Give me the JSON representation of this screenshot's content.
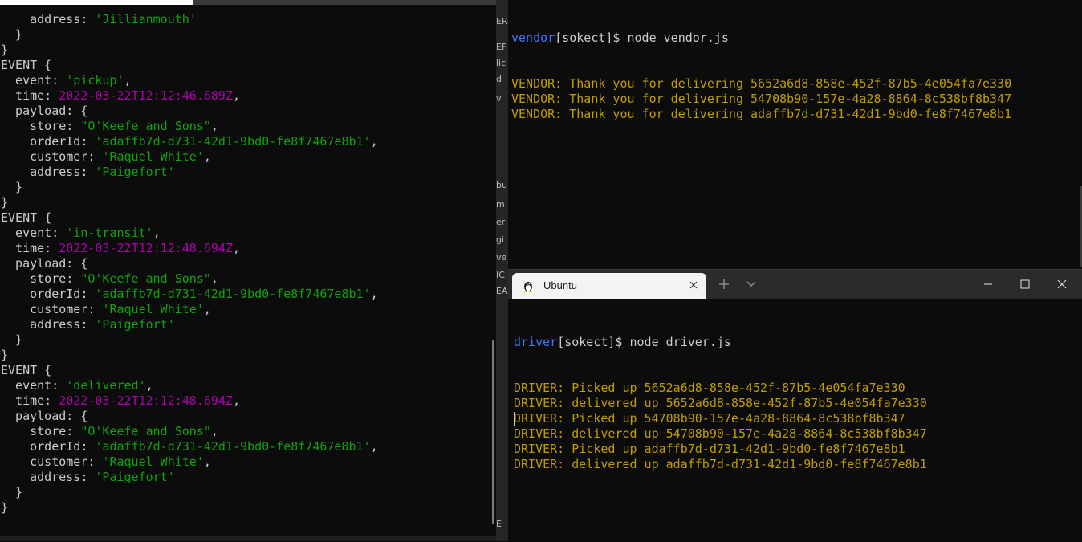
{
  "left_terminal": {
    "lines": [
      [
        {
          "t": "    address: ",
          "c": "white"
        },
        {
          "t": "'Jillianmouth'",
          "c": "green"
        }
      ],
      [
        {
          "t": "  }",
          "c": "white"
        }
      ],
      [
        {
          "t": "}",
          "c": "white"
        }
      ],
      [
        {
          "t": "EVENT {",
          "c": "white"
        }
      ],
      [
        {
          "t": "  event: ",
          "c": "white"
        },
        {
          "t": "'pickup'",
          "c": "green"
        },
        {
          "t": ",",
          "c": "white"
        }
      ],
      [
        {
          "t": "  time: ",
          "c": "white"
        },
        {
          "t": "2022-03-22T12:12:46.689Z",
          "c": "purple"
        },
        {
          "t": ",",
          "c": "white"
        }
      ],
      [
        {
          "t": "  payload: {",
          "c": "white"
        }
      ],
      [
        {
          "t": "    store: ",
          "c": "white"
        },
        {
          "t": "\"O'Keefe and Sons\"",
          "c": "green"
        },
        {
          "t": ",",
          "c": "white"
        }
      ],
      [
        {
          "t": "    orderId: ",
          "c": "white"
        },
        {
          "t": "'adaffb7d-d731-42d1-9bd0-fe8f7467e8b1'",
          "c": "green"
        },
        {
          "t": ",",
          "c": "white"
        }
      ],
      [
        {
          "t": "    customer: ",
          "c": "white"
        },
        {
          "t": "'Raquel White'",
          "c": "green"
        },
        {
          "t": ",",
          "c": "white"
        }
      ],
      [
        {
          "t": "    address: ",
          "c": "white"
        },
        {
          "t": "'Paigefort'",
          "c": "green"
        }
      ],
      [
        {
          "t": "  }",
          "c": "white"
        }
      ],
      [
        {
          "t": "}",
          "c": "white"
        }
      ],
      [
        {
          "t": "EVENT {",
          "c": "white"
        }
      ],
      [
        {
          "t": "  event: ",
          "c": "white"
        },
        {
          "t": "'in-transit'",
          "c": "green"
        },
        {
          "t": ",",
          "c": "white"
        }
      ],
      [
        {
          "t": "  time: ",
          "c": "white"
        },
        {
          "t": "2022-03-22T12:12:48.694Z",
          "c": "purple"
        },
        {
          "t": ",",
          "c": "white"
        }
      ],
      [
        {
          "t": "  payload: {",
          "c": "white"
        }
      ],
      [
        {
          "t": "    store: ",
          "c": "white"
        },
        {
          "t": "\"O'Keefe and Sons\"",
          "c": "green"
        },
        {
          "t": ",",
          "c": "white"
        }
      ],
      [
        {
          "t": "    orderId: ",
          "c": "white"
        },
        {
          "t": "'adaffb7d-d731-42d1-9bd0-fe8f7467e8b1'",
          "c": "green"
        },
        {
          "t": ",",
          "c": "white"
        }
      ],
      [
        {
          "t": "    customer: ",
          "c": "white"
        },
        {
          "t": "'Raquel White'",
          "c": "green"
        },
        {
          "t": ",",
          "c": "white"
        }
      ],
      [
        {
          "t": "    address: ",
          "c": "white"
        },
        {
          "t": "'Paigefort'",
          "c": "green"
        }
      ],
      [
        {
          "t": "  }",
          "c": "white"
        }
      ],
      [
        {
          "t": "}",
          "c": "white"
        }
      ],
      [
        {
          "t": "EVENT {",
          "c": "white"
        }
      ],
      [
        {
          "t": "  event: ",
          "c": "white"
        },
        {
          "t": "'delivered'",
          "c": "green"
        },
        {
          "t": ",",
          "c": "white"
        }
      ],
      [
        {
          "t": "  time: ",
          "c": "white"
        },
        {
          "t": "2022-03-22T12:12:48.694Z",
          "c": "purple"
        },
        {
          "t": ",",
          "c": "white"
        }
      ],
      [
        {
          "t": "  payload: {",
          "c": "white"
        }
      ],
      [
        {
          "t": "    store: ",
          "c": "white"
        },
        {
          "t": "\"O'Keefe and Sons\"",
          "c": "green"
        },
        {
          "t": ",",
          "c": "white"
        }
      ],
      [
        {
          "t": "    orderId: ",
          "c": "white"
        },
        {
          "t": "'adaffb7d-d731-42d1-9bd0-fe8f7467e8b1'",
          "c": "green"
        },
        {
          "t": ",",
          "c": "white"
        }
      ],
      [
        {
          "t": "    customer: ",
          "c": "white"
        },
        {
          "t": "'Raquel White'",
          "c": "green"
        },
        {
          "t": ",",
          "c": "white"
        }
      ],
      [
        {
          "t": "    address: ",
          "c": "white"
        },
        {
          "t": "'Paigefort'",
          "c": "green"
        }
      ],
      [
        {
          "t": "  }",
          "c": "white"
        }
      ],
      [
        {
          "t": "}",
          "c": "white"
        }
      ]
    ]
  },
  "background_strip": {
    "fragments": [
      "ER",
      "lic",
      "d",
      "v",
      "EF",
      "bu",
      "m",
      "er",
      "gi",
      "ve",
      "IC",
      "EA",
      "E"
    ]
  },
  "vendor_terminal": {
    "prompt_user": "vendor",
    "prompt_rest": "[sokect]$ node vendor.js",
    "lines": [
      "VENDOR: Thank you for delivering 5652a6d8-858e-452f-87b5-4e054fa7e330",
      "VENDOR: Thank you for delivering 54708b90-157e-4a28-8864-8c538bf8b347",
      "VENDOR: Thank you for delivering adaffb7d-d731-42d1-9bd0-fe8f7467e8b1"
    ]
  },
  "ubuntu_window": {
    "tab_title": "Ubuntu",
    "prompt_user": "driver",
    "prompt_rest": "[sokect]$ node driver.js",
    "lines": [
      "DRIVER: Picked up 5652a6d8-858e-452f-87b5-4e054fa7e330",
      "DRIVER: delivered up 5652a6d8-858e-452f-87b5-4e054fa7e330",
      "DRIVER: Picked up 54708b90-157e-4a28-8864-8c538bf8b347",
      "DRIVER: delivered up 54708b90-157e-4a28-8864-8c538bf8b347",
      "DRIVER: Picked up adaffb7d-d731-42d1-9bd0-fe8f7467e8b1",
      "DRIVER: delivered up adaffb7d-d731-42d1-9bd0-fe8f7467e8b1"
    ]
  },
  "colors": {
    "white": "#cccccc",
    "green": "#13a10e",
    "purple": "#b000b0",
    "orange": "#c19c00",
    "blue": "#3b78ff"
  },
  "icons": [
    "linux-penguin-icon",
    "close-icon",
    "plus-icon",
    "chevron-down-icon",
    "minimize-icon",
    "maximize-icon",
    "window-close-icon"
  ]
}
